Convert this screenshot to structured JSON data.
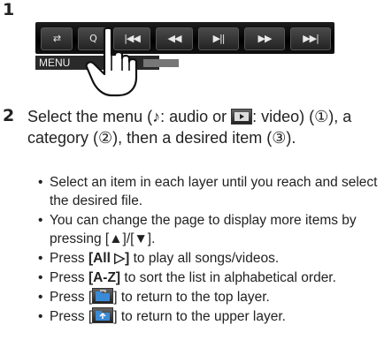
{
  "steps": [
    {
      "number": "1"
    },
    {
      "number": "2"
    }
  ],
  "control_bar": {
    "buttons": [
      {
        "name": "repeat-icon",
        "glyph": "⇄"
      },
      {
        "name": "search-icon",
        "glyph": "Q"
      },
      {
        "name": "prev-track-icon",
        "glyph": "|◀◀"
      },
      {
        "name": "rewind-icon",
        "glyph": "◀◀"
      },
      {
        "name": "play-pause-icon",
        "glyph": "▶||"
      },
      {
        "name": "fast-forward-icon",
        "glyph": "▶▶"
      },
      {
        "name": "next-track-icon",
        "glyph": "▶▶|"
      }
    ],
    "menu_label": "MENU"
  },
  "step2": {
    "part1": "Select the menu (",
    "audio_glyph": "♪",
    "part2": ": audio or ",
    "part3": ": video) (①), a category (②), then a desired item (③)."
  },
  "bullets": {
    "b1": "Select an item in each layer until you reach and select the desired file.",
    "b2": "You can change the page to display more items by pressing [▲]/[▼].",
    "b3_pre": "Press ",
    "b3_key": "[All ▷]",
    "b3_post": " to play all songs/videos.",
    "b4_pre": "Press ",
    "b4_key": "[A-Z]",
    "b4_post": " to sort the list in alphabetical order.",
    "b5_pre": "Press [",
    "b5_post": "] to return to the top layer.",
    "b6_pre": "Press [",
    "b6_post": "] to return to the upper layer."
  }
}
